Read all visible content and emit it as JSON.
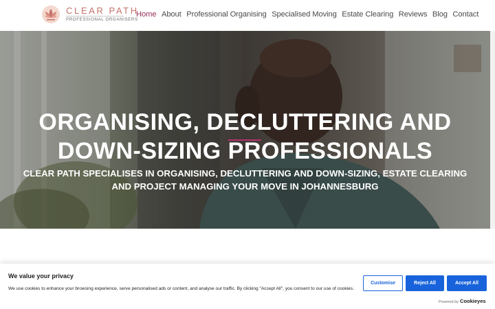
{
  "brand": {
    "name": "CLEAR PATH",
    "tagline": "PROFESSIONAL ORGANISERS",
    "accent_color": "#c4736b",
    "icon": "lotus-logo-icon"
  },
  "nav": {
    "items": [
      {
        "label": "Home",
        "active": true
      },
      {
        "label": "About",
        "active": false
      },
      {
        "label": "Professional Organising",
        "active": false
      },
      {
        "label": "Specialised Moving",
        "active": false
      },
      {
        "label": "Estate Clearing",
        "active": false
      },
      {
        "label": "Reviews",
        "active": false
      },
      {
        "label": "Blog",
        "active": false
      },
      {
        "label": "Contact",
        "active": false
      }
    ],
    "active_color": "#9a2d5a"
  },
  "hero": {
    "title": "ORGANISING, DECLUTTERING AND DOWN-SIZING PROFESSIONALS",
    "subtitle": "CLEAR PATH SPECIALISES IN ORGANISING, DECLUTTERING AND DOWN-SIZING, ESTATE CLEARING AND PROJECT MANAGING YOUR MOVE IN JOHANNESBURG",
    "accent_color": "#b4336e"
  },
  "cookie_banner": {
    "title": "We value your privacy",
    "text": "We use cookies to enhance your browsing experience, serve personalised ads or content, and analyse our traffic. By clicking \"Accept All\", you consent to our use of cookies.",
    "customise_label": "Customise",
    "reject_label": "Reject All",
    "accept_label": "Accept All",
    "powered_by": "Powered by",
    "powered_brand": "Cookieyes",
    "button_color": "#1863dc"
  }
}
